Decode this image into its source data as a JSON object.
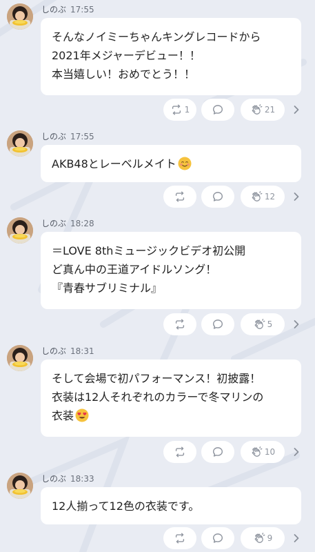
{
  "colors": {
    "background": "#e9ecf3",
    "bubble": "#ffffff",
    "icon": "#9096a0",
    "text": "#222222"
  },
  "messages": [
    {
      "author": "しのぶ",
      "time": "17:55",
      "lines": [
        "そんなノイミーちゃんキングレコードから",
        "2021年メジャーデビュー！！",
        "本当嬉しい！おめでとう！！"
      ],
      "emoji": "",
      "retweets": "1",
      "claps": "21"
    },
    {
      "author": "しのぶ",
      "time": "17:55",
      "lines": [
        "AKB48とレーベルメイト"
      ],
      "emoji": "smiling-face-emoji",
      "retweets": "",
      "claps": "12"
    },
    {
      "author": "しのぶ",
      "time": "18:28",
      "lines": [
        "＝LOVE 8thミュージックビデオ初公開",
        "ど真ん中の王道アイドルソング！",
        "『青春サブリミナル』"
      ],
      "emoji": "",
      "retweets": "",
      "claps": "5"
    },
    {
      "author": "しのぶ",
      "time": "18:31",
      "lines": [
        "そして会場で初パフォーマンス！初披露！",
        "衣装は12人それぞれのカラーで冬マリンの",
        "衣装"
      ],
      "emoji": "heart-eyes-emoji",
      "retweets": "",
      "claps": "10"
    },
    {
      "author": "しのぶ",
      "time": "18:33",
      "lines": [
        "12人揃って12色の衣装です。"
      ],
      "emoji": "",
      "retweets": "",
      "claps": "9"
    }
  ]
}
